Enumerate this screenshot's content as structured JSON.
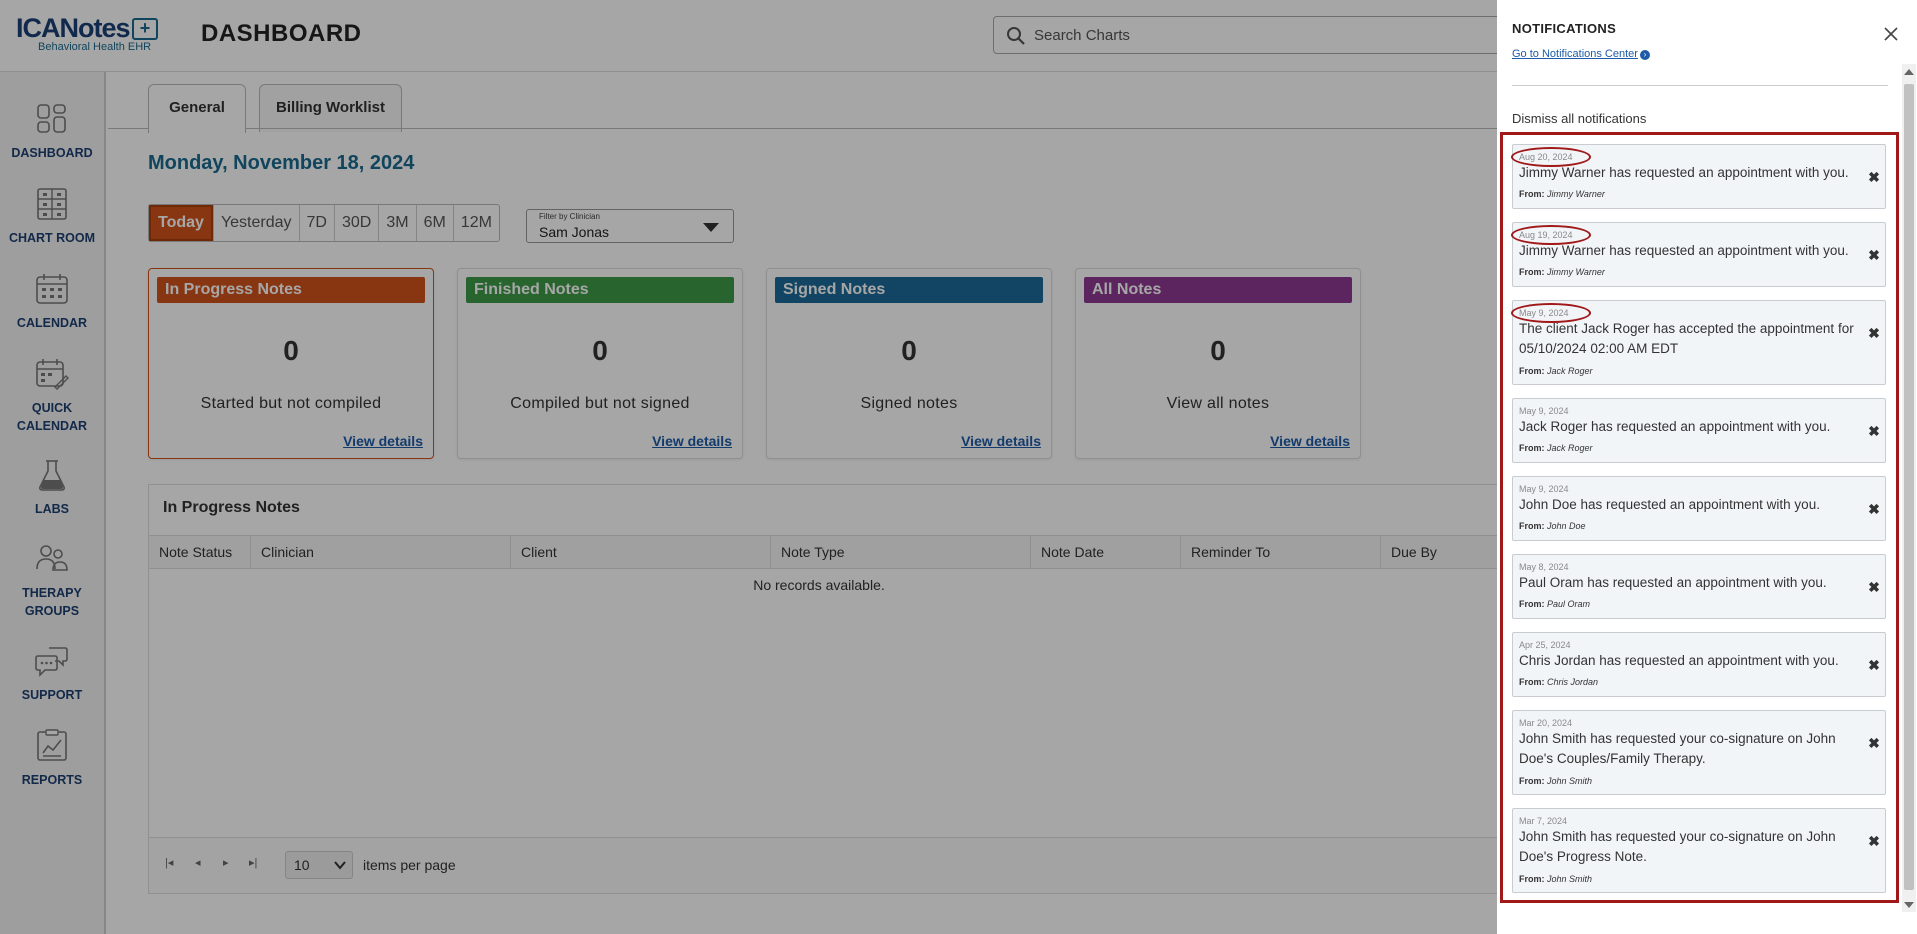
{
  "header": {
    "logo_main": "ICANotes",
    "logo_sub": "Behavioral Health EHR",
    "page_title": "DASHBOARD",
    "search_placeholder": "Search Charts"
  },
  "sidebar": {
    "items": [
      {
        "label": "DASHBOARD",
        "icon": "dashboard-icon"
      },
      {
        "label": "CHART ROOM",
        "icon": "chart-room-icon"
      },
      {
        "label": "CALENDAR",
        "icon": "calendar-icon"
      },
      {
        "label": "QUICK CALENDAR",
        "icon": "quick-calendar-icon"
      },
      {
        "label": "LABS",
        "icon": "flask-icon"
      },
      {
        "label": "THERAPY GROUPS",
        "icon": "group-icon"
      },
      {
        "label": "SUPPORT",
        "icon": "chat-icon"
      },
      {
        "label": "REPORTS",
        "icon": "report-icon"
      }
    ]
  },
  "tabs": [
    "General",
    "Billing Worklist"
  ],
  "date_heading": "Monday, November 18, 2024",
  "range": {
    "options": [
      "Today",
      "Yesterday",
      "7D",
      "30D",
      "3M",
      "6M",
      "12M"
    ],
    "selected": "Today"
  },
  "filter": {
    "label": "Filter by Clinician",
    "value": "Sam Jonas"
  },
  "cards": [
    {
      "title": "In Progress Notes",
      "count": "0",
      "desc": "Started but not compiled",
      "link": "View details",
      "color": "#d2541b"
    },
    {
      "title": "Finished Notes",
      "count": "0",
      "desc": "Compiled but not signed",
      "link": "View details",
      "color": "#3c9a48"
    },
    {
      "title": "Signed Notes",
      "count": "0",
      "desc": "Signed notes",
      "link": "View details",
      "color": "#1b6a99"
    },
    {
      "title": "All Notes",
      "count": "0",
      "desc": "View all notes",
      "link": "View details",
      "color": "#8e3a92"
    }
  ],
  "grid": {
    "title": "In Progress Notes",
    "columns": [
      "Note Status",
      "Clinician",
      "Client",
      "Note Type",
      "Note Date",
      "Reminder To",
      "Due By"
    ],
    "empty": "No records available.",
    "page_size": "10",
    "page_size_label": "items per page"
  },
  "notifications": {
    "title": "NOTIFICATIONS",
    "center_link": "Go to Notifications Center",
    "dismiss_all": "Dismiss all notifications",
    "from_label": "From:",
    "items": [
      {
        "date": "Aug 20, 2024",
        "message": "Jimmy Warner has requested an appointment with you.",
        "from": "Jimmy Warner",
        "circled": true
      },
      {
        "date": "Aug 19, 2024",
        "message": "Jimmy Warner has requested an appointment with you.",
        "from": "Jimmy Warner",
        "circled": true
      },
      {
        "date": "May 9, 2024",
        "message": "The client Jack Roger has accepted the appointment for 05/10/2024 02:00 AM EDT",
        "from": "Jack Roger",
        "circled": true
      },
      {
        "date": "May 9, 2024",
        "message": "Jack Roger has requested an appointment with you.",
        "from": "Jack Roger",
        "circled": false
      },
      {
        "date": "May 9, 2024",
        "message": "John Doe has requested an appointment with you.",
        "from": "John Doe",
        "circled": false
      },
      {
        "date": "May 8, 2024",
        "message": "Paul Oram has requested an appointment with you.",
        "from": "Paul Oram",
        "circled": false
      },
      {
        "date": "Apr 25, 2024",
        "message": "Chris Jordan has requested an appointment with you.",
        "from": "Chris Jordan",
        "circled": false
      },
      {
        "date": "Mar 20, 2024",
        "message": "John Smith has requested your co-signature on John Doe's Couples/Family Therapy.",
        "from": "John Smith",
        "circled": false
      },
      {
        "date": "Mar 7, 2024",
        "message": "John Smith has requested your co-signature on John Doe's Progress Note.",
        "from": "John Smith",
        "circled": false
      }
    ]
  },
  "colors": {
    "brand_blue": "#1b3f75",
    "accent_orange": "#d2541b",
    "highlight_red": "#a01818"
  }
}
